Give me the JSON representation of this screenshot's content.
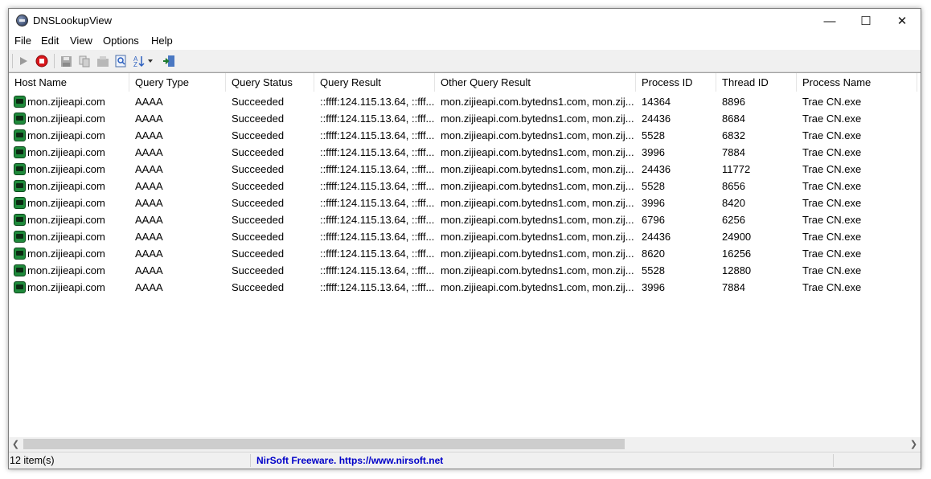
{
  "window": {
    "title": "DNSLookupView"
  },
  "controls": {
    "minimize": "—",
    "maximize": "☐",
    "close": "✕"
  },
  "menu": [
    "File",
    "Edit",
    "View",
    "Options",
    "Help"
  ],
  "toolbar": {
    "icons": [
      "play-icon",
      "stop-icon",
      "save-icon",
      "copy-icon",
      "properties-icon",
      "find-icon",
      "sort-icon",
      "exit-icon"
    ]
  },
  "columns": [
    "Host Name",
    "Query Type",
    "Query Status",
    "Query Result",
    "Other Query Result",
    "Process ID",
    "Thread ID",
    "Process Name"
  ],
  "rows": [
    [
      "mon.zijieapi.com",
      "AAAA",
      "Succeeded",
      "::ffff:124.115.13.64, ::fff...",
      "mon.zijieapi.com.bytedns1.com, mon.zij...",
      "14364",
      "8896",
      "Trae CN.exe"
    ],
    [
      "mon.zijieapi.com",
      "AAAA",
      "Succeeded",
      "::ffff:124.115.13.64, ::fff...",
      "mon.zijieapi.com.bytedns1.com, mon.zij...",
      "24436",
      "8684",
      "Trae CN.exe"
    ],
    [
      "mon.zijieapi.com",
      "AAAA",
      "Succeeded",
      "::ffff:124.115.13.64, ::fff...",
      "mon.zijieapi.com.bytedns1.com, mon.zij...",
      "5528",
      "6832",
      "Trae CN.exe"
    ],
    [
      "mon.zijieapi.com",
      "AAAA",
      "Succeeded",
      "::ffff:124.115.13.64, ::fff...",
      "mon.zijieapi.com.bytedns1.com, mon.zij...",
      "3996",
      "7884",
      "Trae CN.exe"
    ],
    [
      "mon.zijieapi.com",
      "AAAA",
      "Succeeded",
      "::ffff:124.115.13.64, ::fff...",
      "mon.zijieapi.com.bytedns1.com, mon.zij...",
      "24436",
      "11772",
      "Trae CN.exe"
    ],
    [
      "mon.zijieapi.com",
      "AAAA",
      "Succeeded",
      "::ffff:124.115.13.64, ::fff...",
      "mon.zijieapi.com.bytedns1.com, mon.zij...",
      "5528",
      "8656",
      "Trae CN.exe"
    ],
    [
      "mon.zijieapi.com",
      "AAAA",
      "Succeeded",
      "::ffff:124.115.13.64, ::fff...",
      "mon.zijieapi.com.bytedns1.com, mon.zij...",
      "3996",
      "8420",
      "Trae CN.exe"
    ],
    [
      "mon.zijieapi.com",
      "AAAA",
      "Succeeded",
      "::ffff:124.115.13.64, ::fff...",
      "mon.zijieapi.com.bytedns1.com, mon.zij...",
      "6796",
      "6256",
      "Trae CN.exe"
    ],
    [
      "mon.zijieapi.com",
      "AAAA",
      "Succeeded",
      "::ffff:124.115.13.64, ::fff...",
      "mon.zijieapi.com.bytedns1.com, mon.zij...",
      "24436",
      "24900",
      "Trae CN.exe"
    ],
    [
      "mon.zijieapi.com",
      "AAAA",
      "Succeeded",
      "::ffff:124.115.13.64, ::fff...",
      "mon.zijieapi.com.bytedns1.com, mon.zij...",
      "8620",
      "16256",
      "Trae CN.exe"
    ],
    [
      "mon.zijieapi.com",
      "AAAA",
      "Succeeded",
      "::ffff:124.115.13.64, ::fff...",
      "mon.zijieapi.com.bytedns1.com, mon.zij...",
      "5528",
      "12880",
      "Trae CN.exe"
    ],
    [
      "mon.zijieapi.com",
      "AAAA",
      "Succeeded",
      "::ffff:124.115.13.64, ::fff...",
      "mon.zijieapi.com.bytedns1.com, mon.zij...",
      "3996",
      "7884",
      "Trae CN.exe"
    ]
  ],
  "status": {
    "count": "12 item(s)",
    "credit": "NirSoft Freeware. https://www.nirsoft.net"
  },
  "colors": {
    "link": "#0000c8",
    "row_icon": "#1f8a3b"
  }
}
